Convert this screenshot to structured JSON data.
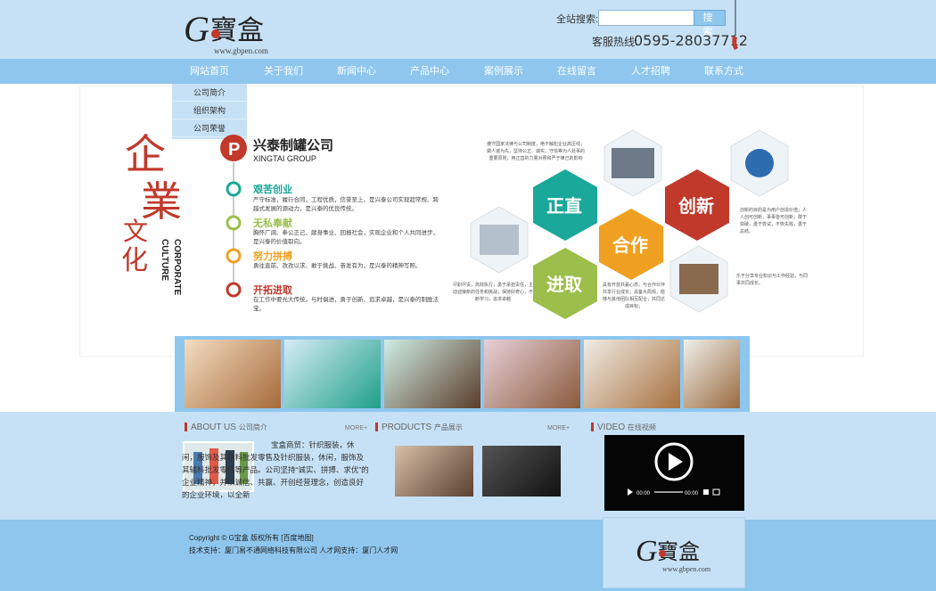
{
  "brand": {
    "logo_text": "寶盒",
    "logo_letter": "G",
    "logo_url": "www.gbpen.com"
  },
  "search": {
    "label": "全站搜索:",
    "button": "搜 索",
    "placeholder": ""
  },
  "hotline": {
    "label": "客服热线:",
    "number": "0595-28037712"
  },
  "nav": [
    "网站首页",
    "关于我们",
    "新闻中心",
    "产品中心",
    "案例展示",
    "在线留言",
    "人才招聘",
    "联系方式"
  ],
  "subnav": [
    "公司简介",
    "组织架构",
    "公司荣誉"
  ],
  "banner": {
    "vertical_cn": "企業文化",
    "vertical_en_1": "CULTURE",
    "vertical_en_2": "CORPORATE",
    "company_cn": "兴泰制罐公司",
    "company_en": "XINGTAI GROUP",
    "values": [
      {
        "title": "艰苦创业",
        "desc": "严守标准，履行合同，工程优质，信誉至上，是兴泰公司实现超常规、跨越式发展的源动力，是兴泰的优良传统。",
        "color": "#1aa89a"
      },
      {
        "title": "无私奉献",
        "desc": "胸怀广阔、奉公正己、献身事业、回报社会，实现企业和个人共同进步，是兴泰的价值取向。",
        "color": "#9bbf4a"
      },
      {
        "title": "努力拼搏",
        "desc": "勇往直前、孜孜以求、敢于挑战、奋发有为，是兴泰的精神写照。",
        "color": "#f0a020"
      },
      {
        "title": "开拓进取",
        "desc": "在工作中要光大传统，与时俱进，勇于创新、追求卓越，是兴泰的制胜法宝。",
        "color": "#c0392b"
      }
    ],
    "hex": [
      {
        "label": "正直",
        "color": "#1aa89a"
      },
      {
        "label": "创新",
        "color": "#c0392b"
      },
      {
        "label": "合作",
        "color": "#f0a020"
      },
      {
        "label": "进取",
        "color": "#9bbf4a"
      }
    ],
    "notes": {
      "top": "遵守国家法律与公司制度，绝不触犯企业高压线；做人诚为先，坚持公正、诚实、守信等为人处事的重要原则；用正直的力量对照和严于律己的影响",
      "right_top": "创新的目的是为用户创造价值；人人创可创新，事事皆可创新；敢于突破，勇于尝试，不恢失败，勇于总结。",
      "left": "尽职尽责，高效执行；勇于承担责任，主动迎接新的任务和挑战；保持好奇心，不断学习，追求卓越",
      "center": "具有开放共赢心态，与合作伙伴共享行业成长；具备大局观，能够与其他团队相互配合，共同达成目标；",
      "right_bottom": "乐于分享专业知识与工作经验，与同事共同成长。"
    }
  },
  "sections": {
    "about": {
      "title_en": "ABOUT US",
      "title_cn": "公司简介",
      "more": "MORE+",
      "text": "宝盒商贸：针织服装，休闲，服饰及其辅料批发零售及针织服装，休闲，服饰及其辅料批发零售等产品。公司坚持“诚实、拼搏、求优”的企业精神，并以诚信、共赢、开创经营理念，创造良好的企业环境，以全新"
    },
    "products": {
      "title_en": "PRODUCTS",
      "title_cn": "产品展示",
      "more": "MORE+"
    },
    "video": {
      "title_en": "VIDEO",
      "title_cn": "在线视频",
      "time_cur": "00:00",
      "time_total": "00:00"
    }
  },
  "footer": {
    "line1": "Copyright © G宝盒  版权所有  [百度地图]",
    "line2": "技术支持：厦门易不通网络科技有限公司  人才网支持：厦门人才网"
  },
  "colors": {
    "nav": "#8ec6ee",
    "bg": "#c6e1f5",
    "red": "#c0392b"
  }
}
